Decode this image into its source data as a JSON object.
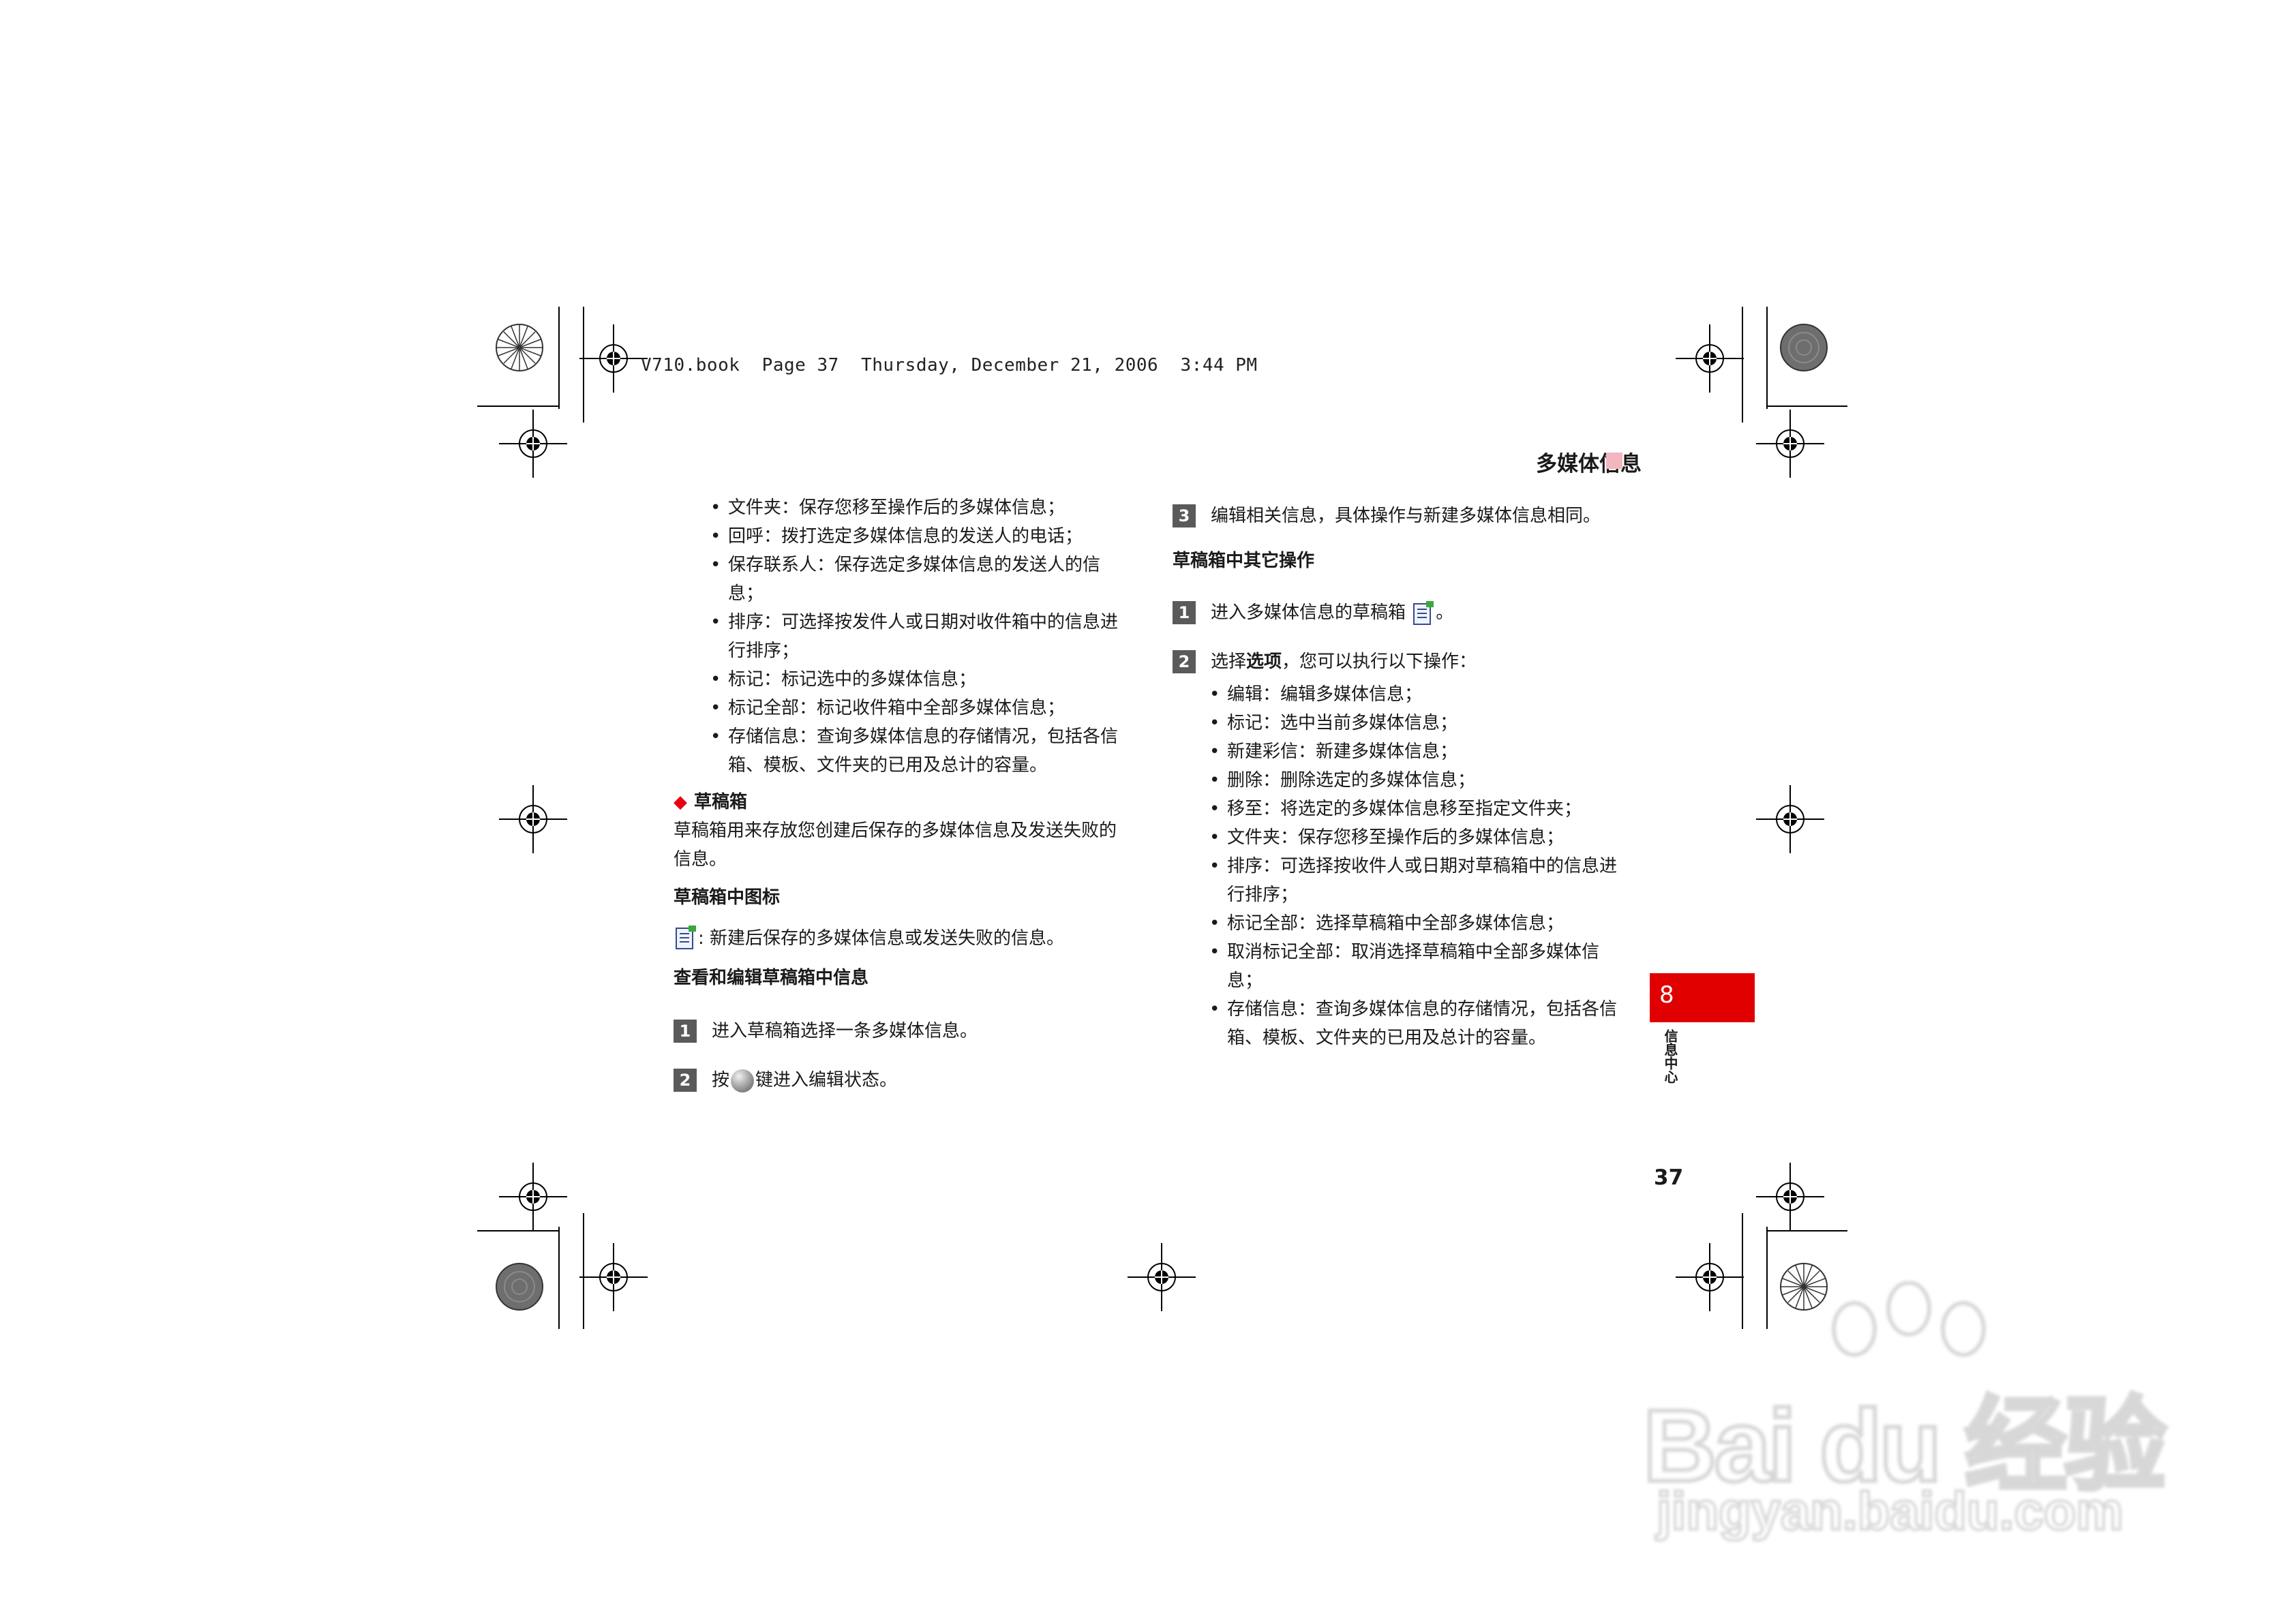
{
  "header_line": "V710.book  Page 37  Thursday, December 21, 2006  3:44 PM",
  "section_title": "多媒体信息",
  "left_bullets": [
    "文件夹：保存您移至操作后的多媒体信息；",
    "回呼：拨打选定多媒体信息的发送人的电话；",
    "保存联系人：保存选定多媒体信息的发送人的信息；",
    "排序：可选择按发件人或日期对收件箱中的信息进行排序；",
    "标记：标记选中的多媒体信息；",
    "标记全部：标记收件箱中全部多媒体信息；",
    "存储信息：查询多媒体信息的存储情况，包括各信箱、模板、文件夹的已用及总计的容量。"
  ],
  "drafts": {
    "heading": "草稿箱",
    "description": "草稿箱用来存放您创建后保存的多媒体信息及发送失败的信息。",
    "icon_heading": "草稿箱中图标",
    "icon_desc": ": 新建后保存的多媒体信息或发送失败的信息。",
    "view_edit_heading": "查看和编辑草稿箱中信息",
    "step1_num": "1",
    "step1_text": "进入草稿箱选择一条多媒体信息。",
    "step2_num": "2",
    "step2_prefix": "按",
    "step2_suffix": "键进入编辑状态。",
    "step3_num": "3",
    "step3_text": "编辑相关信息，具体操作与新建多媒体信息相同。",
    "other_ops_heading": "草稿箱中其它操作",
    "op_step1_num": "1",
    "op_step1_text": "进入多媒体信息的草稿箱",
    "op_step1_end": "。",
    "op_step2_num": "2",
    "op_step2_prefix": "选择",
    "op_step2_bold": "选项",
    "op_step2_suffix": "，您可以执行以下操作：",
    "options": [
      "编辑：编辑多媒体信息；",
      "标记：选中当前多媒体信息；",
      "新建彩信：新建多媒体信息；",
      "删除：删除选定的多媒体信息；",
      "移至：将选定的多媒体信息移至指定文件夹；",
      "文件夹：保存您移至操作后的多媒体信息；",
      "排序：可选择按收件人或日期对草稿箱中的信息进行排序；",
      "标记全部：选择草稿箱中全部多媒体信息；",
      "取消标记全部：取消选择草稿箱中全部多媒体信息；",
      "存储信息：查询多媒体信息的存储情况，包括各信箱、模板、文件夹的已用及总计的容量。"
    ]
  },
  "chapter_tab": {
    "number": "8",
    "label": "信息中心"
  },
  "page_number": "37",
  "watermark": {
    "brand": "Bai du 经验",
    "url": "jingyan.baidu.com"
  },
  "colors": {
    "accent_red": "#e00000",
    "title_square": "#f4b6be",
    "step_box": "#5a5a5a"
  }
}
